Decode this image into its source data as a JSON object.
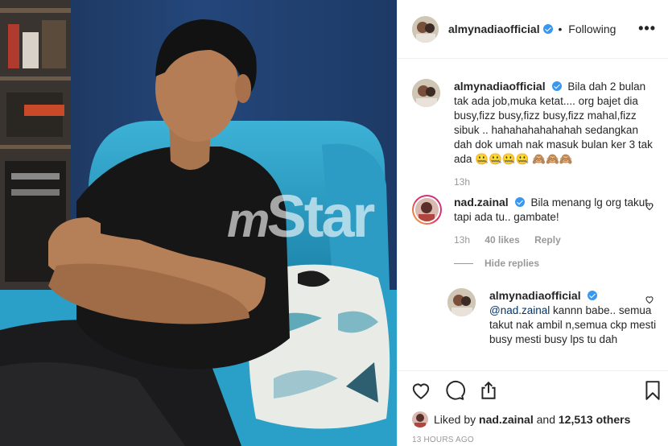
{
  "photo": {
    "watermark": "mStar",
    "watermark_m": "m",
    "watermark_rest": "Star"
  },
  "post": {
    "author": "almynadiaofficial",
    "follow_status": "Following",
    "more_label": "•••"
  },
  "comments": [
    {
      "username": "almynadiaofficial",
      "text": "Bila dah 2 bulan tak ada job,muka ketat.... org bajet dia busy,fizz busy,fizz busy,fizz mahal,fizz sibuk .. hahahahahahahah sedangkan dah dok umah nak masuk bulan ker 3 tak ada 🤐🤐🤐🤐 🙈🙈🙈",
      "time": "13h"
    },
    {
      "username": "nad.zainal",
      "text": "Bila menang lg org takut.. tapi ada tu.. gambate!",
      "time": "13h",
      "likes": "40 likes",
      "reply_label": "Reply"
    }
  ],
  "hide_replies": "Hide replies",
  "reply": {
    "username": "almynadiaofficial",
    "mention": "@nad.zainal",
    "text": " kannn babe.. semua takut nak ambil n,semua ckp mesti busy mesti busy lps tu dah"
  },
  "likes_summary": {
    "prefix": "Liked by ",
    "user": "nad.zainal",
    "middle": " and ",
    "count": "12,513 others"
  },
  "posted_ago": "13 HOURS AGO",
  "colors": {
    "verified": "#3897f0",
    "secondary_text": "#999999",
    "border": "#efefef"
  }
}
